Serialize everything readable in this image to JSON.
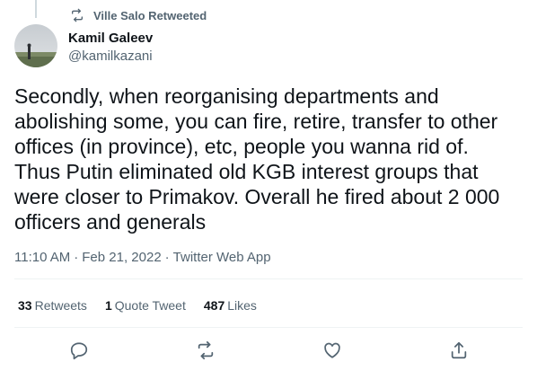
{
  "retweet_context": {
    "icon": "retweet-icon",
    "text": "Ville Salo Retweeted"
  },
  "author": {
    "name": "Kamil Galeev",
    "handle": "@kamilkazani"
  },
  "tweet": {
    "text": "Secondly, when reorganising departments and\nabolishing some, you can fire, retire, transfer to other\noffices (in province), etc, people you wanna rid of.\nThus Putin eliminated old KGB interest groups that\nwere closer to Primakov. Overall he fired about 2 000\nofficers and generals"
  },
  "meta": {
    "time": "11:10 AM",
    "sep1": "·",
    "date": "Feb 21, 2022",
    "sep2": "·",
    "source": "Twitter Web App"
  },
  "stats": {
    "retweets": {
      "count": "33",
      "label": "Retweets"
    },
    "quote_tweets": {
      "count": "1",
      "label": "Quote Tweet"
    },
    "likes": {
      "count": "487",
      "label": "Likes"
    }
  },
  "actions": [
    "reply-icon",
    "retweet-icon",
    "like-icon",
    "share-icon"
  ],
  "colors": {
    "text": "#0f1419",
    "secondary": "#536471",
    "divider": "#eff3f4"
  }
}
